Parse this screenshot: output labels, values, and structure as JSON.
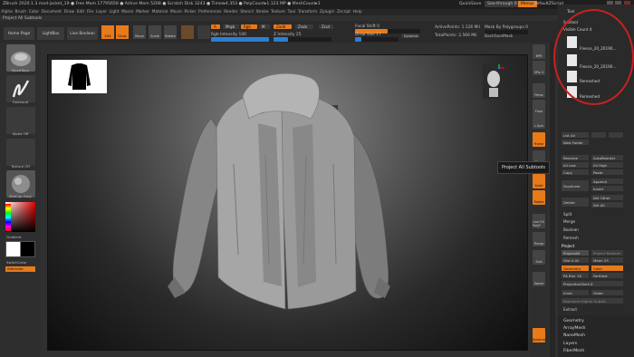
{
  "titlebar": {
    "text": "ZBrush 2020.1.3  mod-jacket_19  ● Free Mem 17795658 ● Active Mem 5208 ● Scratch Disk 3243 ● Timer▸4.353 ● PolyCount▸1.123 MP ● MeshCount▸1",
    "quicksave": "QuickSave",
    "seethrough": "See-through 0",
    "menus": "Menus",
    "script": "DefaultZScript"
  },
  "menus": [
    "Alpha",
    "Brush",
    "Color",
    "Document",
    "Draw",
    "Edit",
    "File",
    "Layer",
    "Light",
    "Macro",
    "Marker",
    "Material",
    "Movie",
    "Picker",
    "Preferences",
    "Render",
    "Stencil",
    "Stroke",
    "Texture",
    "Tool",
    "Transform",
    "Zplugin",
    "Zscript",
    "Help"
  ],
  "subtitle": "Project All Subtools",
  "toolbar": {
    "home": "Home Page",
    "lightbox": "LightBox",
    "boolean": "Live Boolean",
    "edit": "Edit",
    "draw": "Draw",
    "move": "Move",
    "scale": "Scale",
    "rotate": "Rotate",
    "a": "A",
    "mrgb": "Mrgb",
    "rgb": "Rgb",
    "m": "M",
    "zadd": "Zadd",
    "zsub": "Zsub",
    "zcut": "Zcut",
    "rgb_intensity": "Rgb Intensity 100",
    "z_intensity": "Z Intensity 25",
    "focal_shift": "Focal Shift 0",
    "draw_size": "Draw Size 17",
    "dynamic": "Dynamic",
    "active_points": "ActivePoints: 1.126 Mil",
    "total_points": "TotalPoints: 2.566 Mil",
    "mask_poly": "Mask By Polygroups 0",
    "backface": "BackfaceMask"
  },
  "leftshelf": {
    "items": [
      "MoveTopo",
      "Freehand",
      "Alpha Off",
      "Texture Off",
      "MatCap Gray"
    ],
    "gradient": "Gradient",
    "switch": "SwitchColor",
    "alternate": "Alternate"
  },
  "righticons": [
    "BPR",
    "SPix 3",
    "Persp",
    "Floor",
    "L.Sym",
    "Frame",
    "Move",
    "Scale",
    "Rotate",
    "Line Fill PolyF",
    "Transp",
    "Solo",
    "Xpose",
    "Dynamic"
  ],
  "tooltip": "Project All Subtools",
  "rightpanel": {
    "top_label": "Tool",
    "subtool_header": "Subtool",
    "visible_count": "Visible Count 4",
    "subtools": [
      "Fleece_20_20190...",
      "Fleece_20_20190...",
      "Remeshed",
      "Remeshed"
    ],
    "buttons": {
      "list_all": "List All",
      "new_folder": "New Folder",
      "rename": "Rename",
      "autoreorder": "AutoReorder",
      "all_low": "All Low",
      "all_high": "All High",
      "copy": "Copy",
      "paste": "Paste",
      "duplicate": "Duplicate",
      "append": "Append",
      "insert": "Insert",
      "delete": "Delete",
      "del_other": "Del Other",
      "del_all": "Del All",
      "split": "Split",
      "merge": "Merge",
      "boolean": "Boolean",
      "remesh": "Remesh",
      "project": "Project",
      "projectall": "ProjectAll",
      "project_boolean": "Project Boolean",
      "dist": "Dist 0.02",
      "mean": "Mean 25",
      "geometry": "Geometry",
      "color": "Color",
      "pa_blur": "PA Blur 10",
      "farthest": "Farthest",
      "projection_shell": "ProjectionShell 0",
      "inner": "Inner",
      "outer": "Outer",
      "reproject": "Reproject Higher Subdiv",
      "extract": "Extract"
    },
    "bottom": [
      "Geometry",
      "ArrayMesh",
      "NanoMesh",
      "Layers",
      "FiberMesh"
    ]
  },
  "colors": {
    "accent": "#e87a1a",
    "annotation": "#c82020",
    "slider": "#2d7fd0"
  }
}
